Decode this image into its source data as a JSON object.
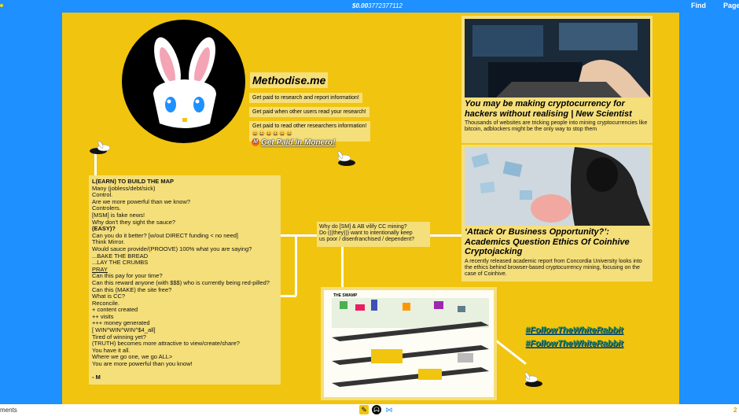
{
  "topbar": {
    "balance_prefix": "$",
    "balance_whole": "0.00",
    "balance_fraction": "3772377112",
    "find_label": "Find",
    "page_label": "Page"
  },
  "logo": {
    "alt": "white rabbit logo"
  },
  "brand": {
    "title": "Methodise.me",
    "taglines": [
      "Get paid to research and report information!",
      "Get paid when other users read your research!",
      "Get paid to read other researchers information!"
    ],
    "cta": "Get Paid in Monero!"
  },
  "manifesto": {
    "lines": [
      "L(EARN) TO BUILD THE MAP",
      "Many (jobless/debt/sick)",
      "Control.",
      "Are we more powerful than we know?",
      "Controlers.",
      "[MSM] is fake news!",
      "Why don't they sight the sauce?",
      "(EASY)?",
      "Can you do it better? [w/out DIRECT funding < no need]",
      "Think Mirror.",
      "Would sauce provide/(PROOVE) 100% what you are saying?",
      "...BAKE THE BREAD",
      "...LAY THE CRUMBS",
      " PRAY",
      "Can this pay for your time?",
      "Can this reward anyone (with $$$) who is currently being red-pilled?",
      "Can this (MAKE) the site free?",
      "What is CC?",
      "Reconcile.",
      "+ content created",
      "++ visits",
      "+++ money generated",
      "[              WIN^WIN^WIN^$4_all]",
      "Tired of winning yet?",
      "(TRUTH) becomes more attractive to view/create/share?",
      "You have it all.",
      "Where we go one, we go ALL>",
      "You are more powerful than you know!",
      "",
      "- M"
    ]
  },
  "why_box": {
    "lines": [
      "Why do [SM] & AB vilify CC mining?",
      "Do (((they))) want to intentionally keep",
      "us poor / disenfranchised / dependent?"
    ]
  },
  "articles": [
    {
      "title": "You may be making cryptocurrency for hackers without realising | New Scientist",
      "description": "Thousands of websites are tricking people into mining cryptocurrencies like bitcoin, adblockers might be the only way to stop them"
    },
    {
      "title": "‘Attack Or Business Opportunity?’: Academics Question Ethics Of Coinhive Cryptojacking",
      "description": "A recently released academic report from Concordia University looks into the ethics behind browser-based cryptocurrency mining, focusing on the case of Coinhive."
    }
  ],
  "swamp": {
    "title": "THE SWAMP"
  },
  "hashtags": [
    "#FollowTheWhiteRabbit",
    "#FollowTheWhiteRabbit"
  ],
  "bottombar": {
    "left_text": "ments",
    "right_text": "2"
  },
  "colors": {
    "background": "#1e90ff",
    "canvas": "#f1c40f",
    "panel": "#f5df7a",
    "monero": "#f26822"
  }
}
